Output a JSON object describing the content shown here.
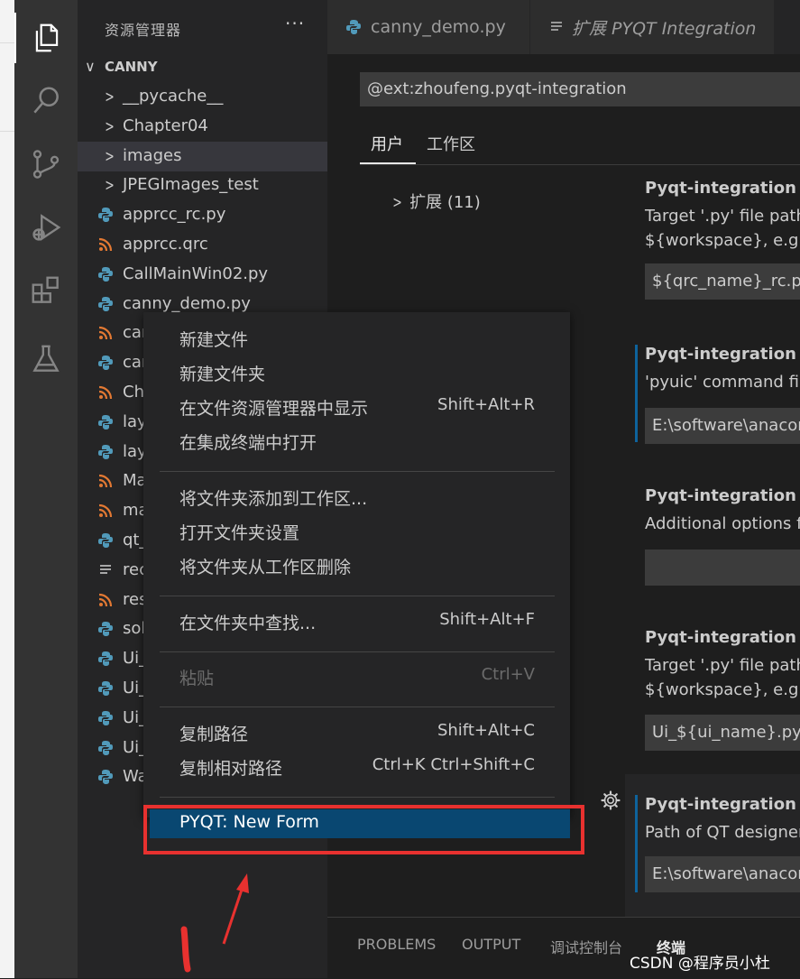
{
  "sidebar": {
    "title": "资源管理器",
    "more": "···",
    "folder": "CANNY",
    "items": [
      {
        "label": "__pycache__",
        "type": "folder"
      },
      {
        "label": "Chapter04",
        "type": "folder"
      },
      {
        "label": "images",
        "type": "folder",
        "selected": true
      },
      {
        "label": "JPEGImages_test",
        "type": "folder"
      },
      {
        "label": "apprcc_rc.py",
        "type": "python"
      },
      {
        "label": "apprcc.qrc",
        "type": "rss"
      },
      {
        "label": "CallMainWin02.py",
        "type": "python"
      },
      {
        "label": "canny_demo.py",
        "type": "python"
      },
      {
        "label": "car",
        "type": "rss"
      },
      {
        "label": "car",
        "type": "python"
      },
      {
        "label": "Ch",
        "type": "rss"
      },
      {
        "label": "lay",
        "type": "python"
      },
      {
        "label": "lay",
        "type": "python"
      },
      {
        "label": "Ma",
        "type": "rss"
      },
      {
        "label": "ma",
        "type": "rss"
      },
      {
        "label": "qt_",
        "type": "python"
      },
      {
        "label": "rec",
        "type": "lines"
      },
      {
        "label": "res",
        "type": "rss"
      },
      {
        "label": "sol",
        "type": "python"
      },
      {
        "label": "Ui_",
        "type": "python"
      },
      {
        "label": "Ui_",
        "type": "python"
      },
      {
        "label": "Ui_",
        "type": "python"
      },
      {
        "label": "Ui_",
        "type": "python"
      },
      {
        "label": "Wa",
        "type": "python"
      }
    ]
  },
  "tabs": [
    {
      "label": "canny_demo.py",
      "icon": "python-icon"
    },
    {
      "label": "扩展 PYQT Integration",
      "icon": "lines-icon"
    }
  ],
  "settings": {
    "search_value": "@ext:zhoufeng.pyqt-integration",
    "scope_user": "用户",
    "scope_workspace": "工作区",
    "toc_item": "扩展 (11)",
    "items": [
      {
        "title": "Pyqt-integration › P",
        "desc1": "Target '.py' file path",
        "desc2": "${workspace}, e.g. ${",
        "value": "${qrc_name}_rc.py"
      },
      {
        "title": "Pyqt-integration › P",
        "desc1": "'pyuic' command file",
        "desc2": "",
        "value": "E:\\software\\anacon"
      },
      {
        "title": "Pyqt-integration › P",
        "desc1": "Additional options fo",
        "desc2": "",
        "value": ""
      },
      {
        "title": "Pyqt-integration › P",
        "desc1": "Target '.py' file path",
        "desc2": "${workspace}, e.g. ${",
        "value": "Ui_${ui_name}.py"
      },
      {
        "title": "Pyqt-integration › Q",
        "desc1": "Path of QT designer",
        "desc2": "",
        "value": "E:\\software\\anacon"
      }
    ]
  },
  "panel": {
    "tabs": [
      "PROBLEMS",
      "OUTPUT",
      "调试控制台",
      "终端"
    ],
    "watermark": "CSDN @程序员小杜"
  },
  "context_menu": {
    "items": [
      {
        "label": "新建文件",
        "shortcut": ""
      },
      {
        "label": "新建文件夹",
        "shortcut": ""
      },
      {
        "label": "在文件资源管理器中显示",
        "shortcut": "Shift+Alt+R"
      },
      {
        "label": "在集成终端中打开",
        "shortcut": ""
      },
      {
        "label": "将文件夹添加到工作区...",
        "shortcut": ""
      },
      {
        "label": "打开文件夹设置",
        "shortcut": ""
      },
      {
        "label": "将文件夹从工作区删除",
        "shortcut": ""
      },
      {
        "label": "在文件夹中查找...",
        "shortcut": "Shift+Alt+F"
      },
      {
        "label": "粘贴",
        "shortcut": "Ctrl+V"
      },
      {
        "label": "复制路径",
        "shortcut": "Shift+Alt+C"
      },
      {
        "label": "复制相对路径",
        "shortcut": "Ctrl+K Ctrl+Shift+C"
      },
      {
        "label": "PYQT: New Form",
        "shortcut": ""
      }
    ]
  },
  "colors": {
    "accent": "#094771",
    "annotation": "#e8312f",
    "python_blue": "#519aba",
    "rss_orange": "#e37933"
  }
}
